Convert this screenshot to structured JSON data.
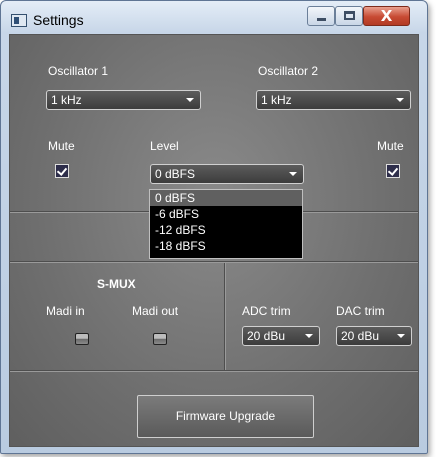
{
  "window": {
    "title": "Settings",
    "close_glyph": "X"
  },
  "oscillator1": {
    "label": "Oscillator 1",
    "value": "1 kHz"
  },
  "oscillator2": {
    "label": "Oscillator 2",
    "value": "1 kHz"
  },
  "mute_left": {
    "label": "Mute",
    "checked": true
  },
  "mute_right": {
    "label": "Mute",
    "checked": true
  },
  "level": {
    "label": "Level",
    "value": "0 dBFS",
    "options": [
      "0 dBFS",
      "-6 dBFS",
      "-12 dBFS",
      "-18 dBFS"
    ]
  },
  "smux": {
    "title": "S-MUX",
    "madi_in_label": "Madi in",
    "madi_out_label": "Madi out"
  },
  "adc_trim": {
    "label": "ADC trim",
    "value": "20 dBu"
  },
  "dac_trim": {
    "label": "DAC trim",
    "value": "20 dBu"
  },
  "firmware": {
    "label": "Firmware Upgrade"
  },
  "colors": {
    "panel": "#6f6f6f",
    "list_bg": "#000000",
    "selected": "#606060",
    "close": "#c74a33"
  }
}
